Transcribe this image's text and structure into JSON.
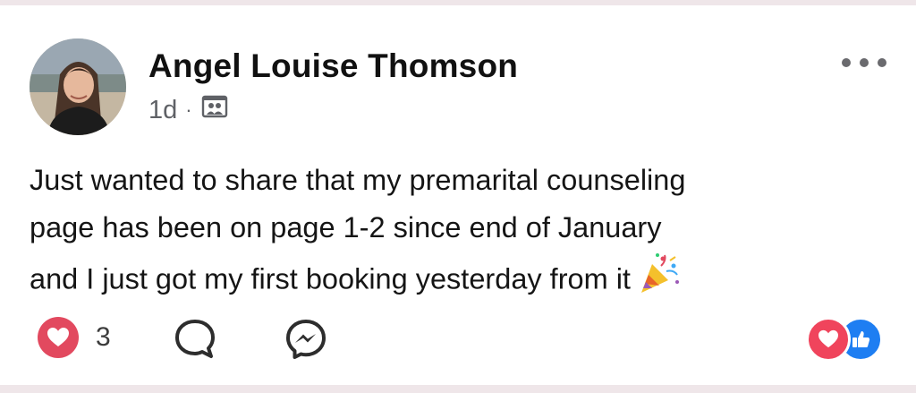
{
  "post": {
    "author": "Angel Louise Thomson",
    "time": "1d",
    "separator": "·",
    "audience_icon": "group-audience-icon",
    "more_icon": "more-options-icon",
    "text_lines": [
      "Just wanted to share that my premarital counseling",
      "page has been on page 1-2 since end of January",
      "and I just got my first booking yesterday from it"
    ],
    "emoji": "party-popper-icon"
  },
  "actions": {
    "reaction_icon": "heart-reaction-icon",
    "reaction_count": "3",
    "comment_icon": "comment-icon",
    "messenger_icon": "messenger-icon"
  },
  "reaction_summary": {
    "love_icon": "love-icon",
    "like_icon": "like-icon"
  },
  "colors": {
    "love": "#e2495f",
    "like": "#1e7ef2",
    "text": "#151515",
    "muted": "#5f6166"
  }
}
